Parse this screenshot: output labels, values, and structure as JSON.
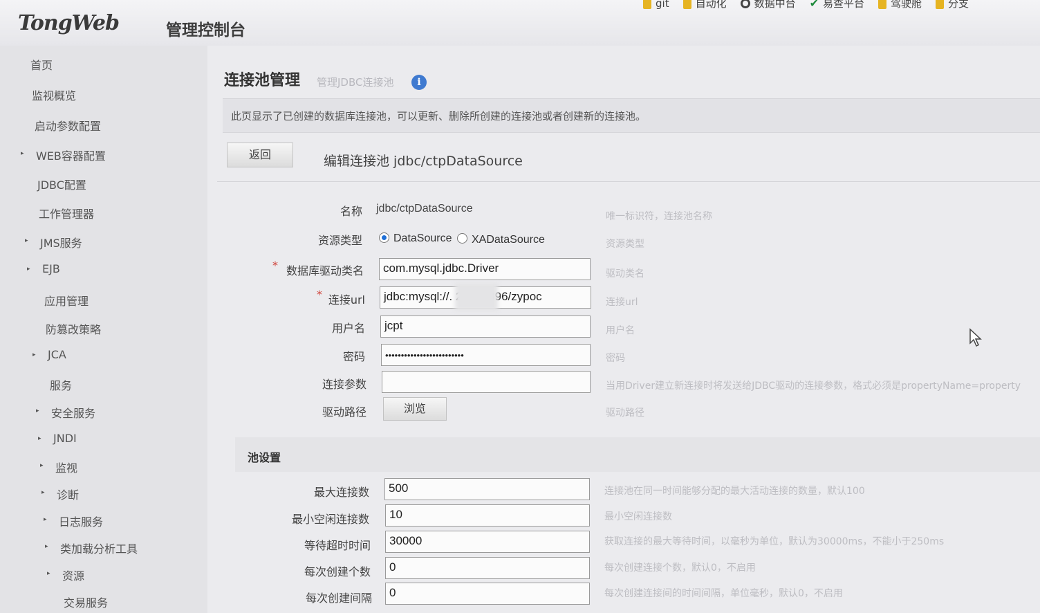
{
  "header": {
    "logo": "TongWeb",
    "console_title": "管理控制台",
    "bookmarks": [
      {
        "label": "git",
        "icon": "folder-icon"
      },
      {
        "label": "自动化",
        "icon": "folder-icon"
      },
      {
        "label": "数据中台",
        "icon": "globe-icon"
      },
      {
        "label": "易查平台",
        "icon": "check-icon"
      },
      {
        "label": "驾驶舱",
        "icon": "folder-icon"
      },
      {
        "label": "分支",
        "icon": "folder-icon"
      }
    ]
  },
  "sidebar": {
    "items": [
      {
        "label": "首页"
      },
      {
        "label": "监视概览"
      },
      {
        "label": "启动参数配置"
      },
      {
        "label": "WEB容器配置"
      },
      {
        "label": "JDBC配置"
      },
      {
        "label": "工作管理器"
      },
      {
        "label": "JMS服务"
      },
      {
        "label": "EJB"
      },
      {
        "label": "应用管理"
      },
      {
        "label": "防篡改策略"
      },
      {
        "label": "JCA"
      },
      {
        "label": "服务"
      },
      {
        "label": "安全服务"
      },
      {
        "label": "JNDI"
      },
      {
        "label": "监视"
      },
      {
        "label": "诊断"
      },
      {
        "label": "日志服务"
      },
      {
        "label": "类加载分析工具"
      },
      {
        "label": "资源"
      },
      {
        "label": "交易服务"
      }
    ]
  },
  "page": {
    "title": "连接池管理",
    "subtitle": "管理JDBC连接池",
    "description": "此页显示了已创建的数据库连接池，可以更新、删除所创建的连接池或者创建新的连接池。",
    "back_button": "返回",
    "edit_heading": "编辑连接池 jdbc/ctpDataSource"
  },
  "form": {
    "name_label": "名称",
    "name_value": "jdbc/ctpDataSource",
    "name_hint": "唯一标识符，连接池名称",
    "type_label": "资源类型",
    "type_option_1": "DataSource",
    "type_option_2": "XADataSource",
    "type_selected": "DataSource",
    "type_hint": "资源类型",
    "required_mark": "*",
    "driver_label": "数据库驱动类名",
    "driver_value": "com.mysql.jdbc.Driver",
    "driver_hint": "驱动类名",
    "url_label": "连接url",
    "url_value": "jdbc:mysql://.          2.85:8896/zypoc",
    "url_hint": "连接url",
    "user_label": "用户名",
    "user_value": "jcpt",
    "user_hint": "用户名",
    "password_label": "密码",
    "password_value": "•••••••••••••••••••••••••",
    "password_hint": "密码",
    "params_label": "连接参数",
    "params_value": "",
    "params_hint": "当用Driver建立新连接时将发送给JDBC驱动的连接参数，格式必须是propertyName=property",
    "driver_path_label": "驱动路径",
    "browse_button": "浏览",
    "driver_path_hint": "驱动路径"
  },
  "pool": {
    "section_title": "池设置",
    "max_label": "最大连接数",
    "max_value": "500",
    "max_hint": "连接池在同一时间能够分配的最大活动连接的数量，默认100",
    "min_idle_label": "最小空闲连接数",
    "min_idle_value": "10",
    "min_idle_hint": "最小空闲连接数",
    "timeout_label": "等待超时时间",
    "timeout_value": "30000",
    "timeout_hint": "获取连接的最大等待时间，以毫秒为单位，默认为30000ms，不能小于250ms",
    "create_count_label": "每次创建个数",
    "create_count_value": "0",
    "create_count_hint": "每次创建连接个数，默认0，不启用",
    "create_interval_label": "每次创建间隔",
    "create_interval_value": "0",
    "create_interval_hint": "每次创建连接间的时间间隔，单位毫秒，默认0，不启用"
  }
}
